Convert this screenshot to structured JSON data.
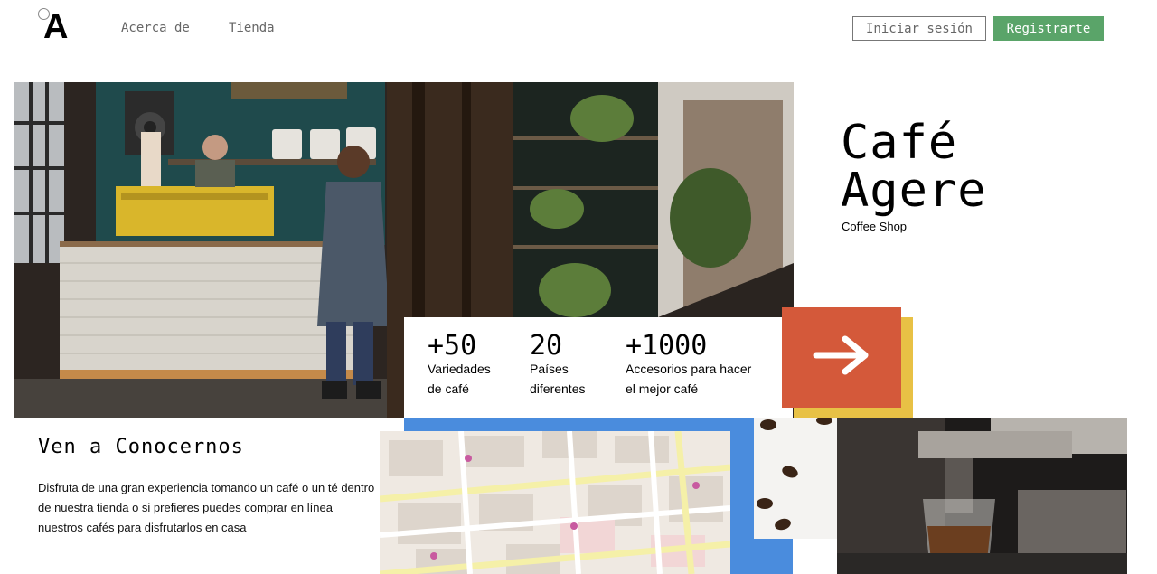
{
  "header": {
    "logo": "A",
    "nav": [
      "Acerca de",
      "Tienda"
    ],
    "login_label": "Iniciar sesión",
    "register_label": "Registrarte"
  },
  "hero": {
    "title_line1": "Café",
    "title_line2": "Agere",
    "subtitle": "Coffee Shop"
  },
  "stats": [
    {
      "value": "+50",
      "label_line1": "Variedades",
      "label_line2": "de café"
    },
    {
      "value": "20",
      "label_line1": "Países",
      "label_line2": "diferentes"
    },
    {
      "value": "+1000",
      "label_line1": "Accesorios para hacer",
      "label_line2": "el mejor café"
    }
  ],
  "about": {
    "title": "Ven a Conocernos",
    "text": "Disfruta de una gran experiencia tomando un café o un té dentro de nuestra tienda o si prefieres puedes comprar en línea nuestros cafés para disfrutarlos en casa"
  },
  "colors": {
    "accent_green": "#5aa469",
    "arrow_orange": "#d4593a",
    "accent_yellow": "#e8c145",
    "accent_blue": "#4a8cdd"
  },
  "icons": {
    "arrow": "arrow-right-icon"
  }
}
